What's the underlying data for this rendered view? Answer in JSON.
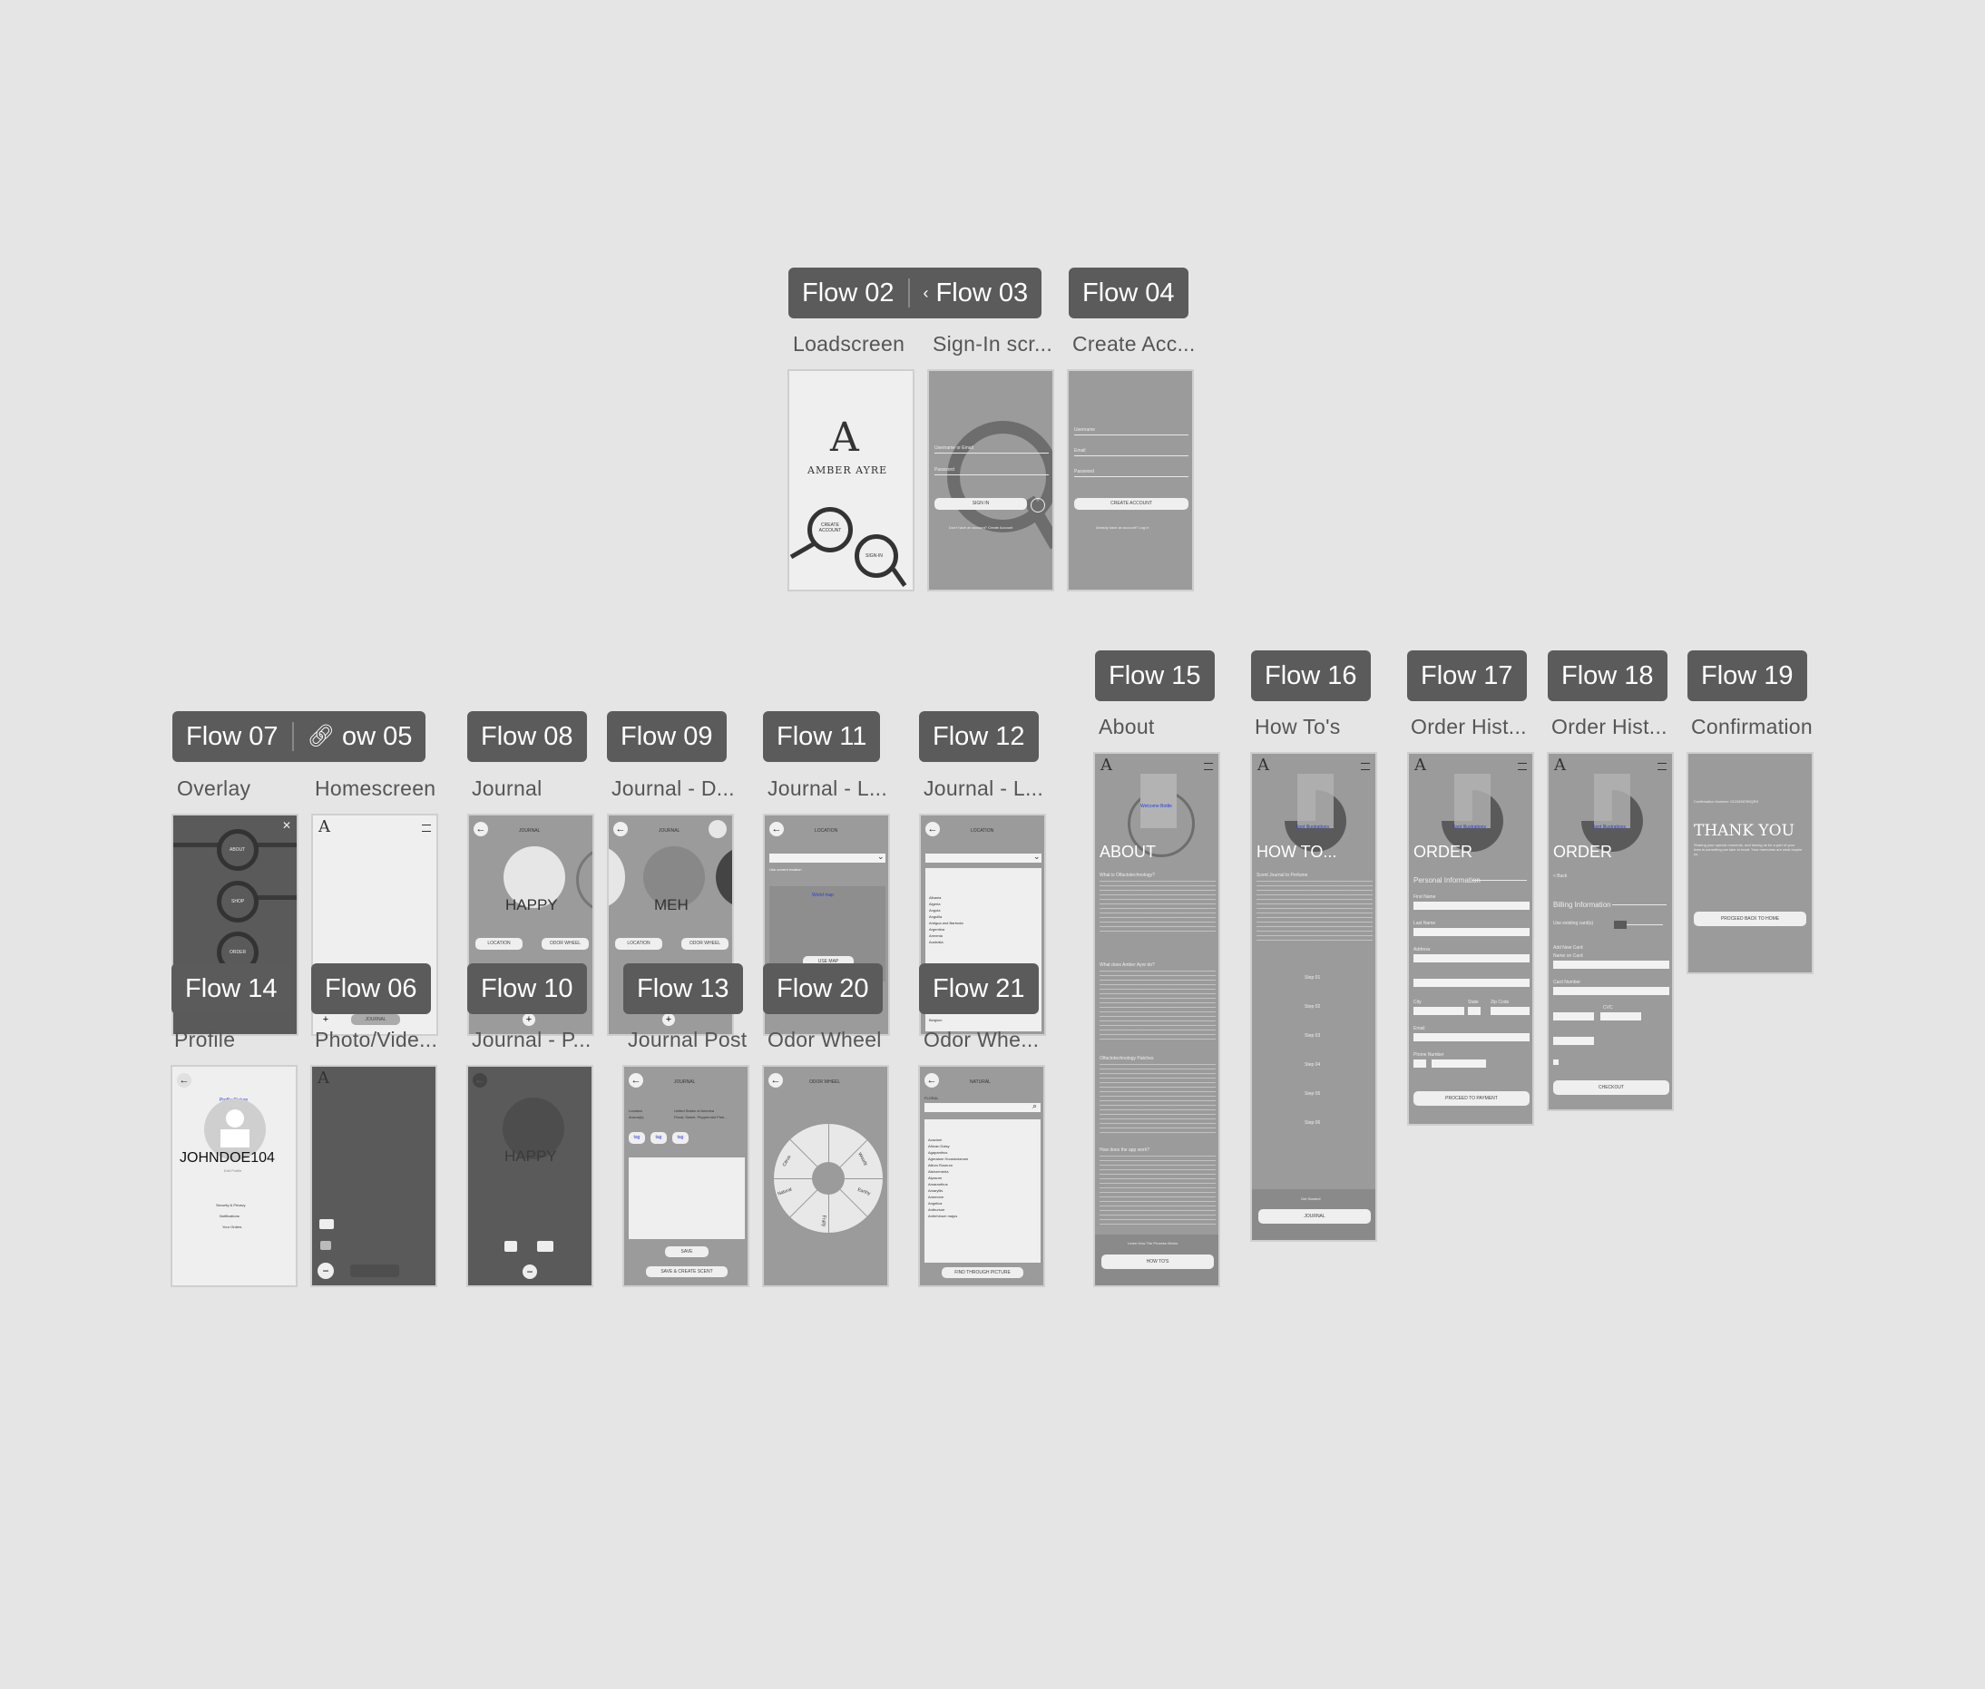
{
  "groups": [
    {
      "tag": "Flow 02",
      "label": "Loadscreen"
    },
    {
      "tag": "Flow 03",
      "label": "Sign-In scr..."
    },
    {
      "tag": "Flow 04",
      "label": "Create Acc..."
    },
    {
      "tag": "Flow 07",
      "label": "Overlay"
    },
    {
      "tag": "ow 05",
      "label": "Homescreen"
    },
    {
      "tag": "Flow 08",
      "label": "Journal"
    },
    {
      "tag": "Flow 09",
      "label": "Journal - D..."
    },
    {
      "tag": "Flow 11",
      "label": "Journal - L..."
    },
    {
      "tag": "Flow 12",
      "label": "Journal - L..."
    },
    {
      "tag": "Flow 14",
      "label": "Profile"
    },
    {
      "tag": "Flow 06",
      "label": "Photo/Vide..."
    },
    {
      "tag": "Flow 10",
      "label": "Journal - P..."
    },
    {
      "tag": "Flow 13",
      "label": "Journal Post"
    },
    {
      "tag": "Flow 20",
      "label": "Odor Wheel"
    },
    {
      "tag": "Flow 21",
      "label": "Odor Whe..."
    },
    {
      "tag": "Flow 15",
      "label": "About"
    },
    {
      "tag": "Flow 16",
      "label": "How To's"
    },
    {
      "tag": "Flow 17",
      "label": "Order Hist..."
    },
    {
      "tag": "Flow 18",
      "label": "Order Hist..."
    },
    {
      "tag": "Flow 19",
      "label": "Confirmation"
    }
  ],
  "loadscreen": {
    "brand": "AMBER AYRE",
    "create": "CREATE ACCOUNT",
    "signin": "SIGN-IN"
  },
  "signin": {
    "user": "Username or Email",
    "pass": "Password",
    "button": "SIGN IN",
    "footer": "Don't have an account? Create Account"
  },
  "create": {
    "user": "Username",
    "email": "Email",
    "pass": "Password",
    "button": "CREATE ACCOUNT",
    "footer": "Already have an account? Log In"
  },
  "overlay": {
    "about": "ABOUT",
    "shop": "SHOP",
    "order": "ORDER"
  },
  "home": {
    "journal": "JOURNAL"
  },
  "journal": {
    "title": "JOURNAL",
    "mood_happy": "HAPPY",
    "mood_meh": "MEH",
    "location": "LOCATION",
    "odor": "ODOR WHEEL"
  },
  "location": {
    "title": "LOCATION",
    "current": "Use current location",
    "world": "World map",
    "use_map": "USE MAP",
    "countries": [
      "Albania",
      "Algeria",
      "Angola",
      "Anguilla",
      "Antigua and Barbuda",
      "Argentina",
      "Armenia",
      "Australia",
      "Belgium"
    ]
  },
  "profile": {
    "pic": "Profile Picture",
    "name": "JOHNDOE104",
    "edit": "Edit Profile",
    "links": [
      "Security & Privacy",
      "Notifications",
      "Your Orders"
    ]
  },
  "post": {
    "title": "JOURNAL",
    "loc_label": "Location",
    "loc_val": "United States of America",
    "aroma_label": "Aroma(s)",
    "aroma_val": "Floral, Sweet, Peppermint Pine...",
    "tags": [
      "tag",
      "tag",
      "tag"
    ],
    "save": "SAVE",
    "save_create": "SAVE & CREATE SCENT"
  },
  "wheel": {
    "title": "ODOR WHEEL",
    "segments": [
      "Citrus",
      "Woody",
      "Natural",
      "Earthy",
      "Fruity"
    ]
  },
  "wheel_list": {
    "title": "NATURAL",
    "sub": "FLORAL",
    "items": [
      "Acacium",
      "African Daisy",
      "Agapanthus",
      "Ageratum Houstonianum",
      "Allium Roseum",
      "Alstroemeria",
      "Alyssum",
      "Amaranthus",
      "Amaryllis",
      "Anemone",
      "Angelica",
      "Anthurium",
      "Antirrhinum majus"
    ],
    "button": "FIND THROUGH PICTURE"
  },
  "about": {
    "pic": "Welcome Bottle",
    "heading": "ABOUT",
    "q1": "What is Olfactotechnology?",
    "q2": "What does Amber Ayre do?",
    "q3": "Olfactotechnology Patches",
    "q4": "How does the app work?",
    "footer": "Learn How The Process Works",
    "button": "HOW TO'S"
  },
  "howto": {
    "pic": "Spot Illustrations",
    "heading": "HOW TO...",
    "sub": "Scent Journal to Perfume",
    "steps": [
      "Step 01",
      "Step 02",
      "Step 03",
      "Step 04",
      "Step 05",
      "Step 06"
    ],
    "footer": "Get Started!",
    "button": "JOURNAL"
  },
  "order1": {
    "pic": "Spot Illustrations",
    "heading": "ORDER",
    "section": "Personal Information",
    "fields": [
      "First Name",
      "Last Name",
      "Address",
      "City",
      "State",
      "Zip Code",
      "Email",
      "Phone Number"
    ],
    "button": "PROCEED TO PAYMENT"
  },
  "order2": {
    "pic": "Spot Illustrations",
    "heading": "ORDER",
    "back": "< Back",
    "section": "Billing Information",
    "fields": [
      "Use existing card(s)",
      "Add New Card",
      "Name on Card",
      "Card Number",
      "CVC"
    ],
    "button": "CHECKOUT"
  },
  "confirm": {
    "number": "Confirmation Number: 0123456789QRS",
    "heading": "THANK YOU",
    "body": "Sharing your special moments, and having us be a part of your lives is something we take to heart. Your memories are what inspire us.",
    "button": "PROCEED BACK TO HOME"
  }
}
